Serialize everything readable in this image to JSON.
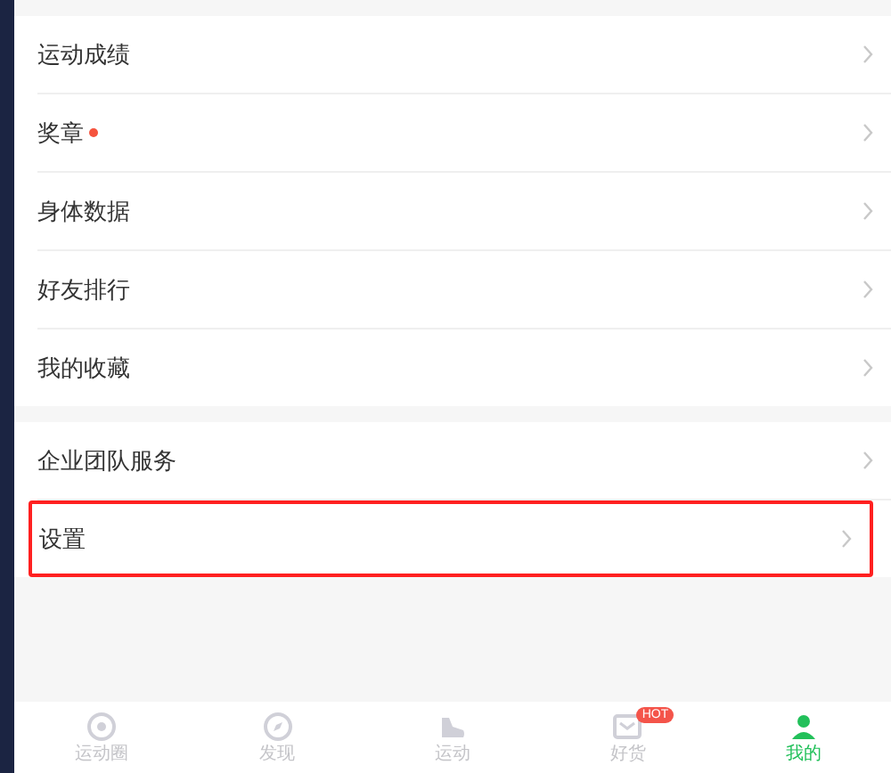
{
  "menu_groups": [
    {
      "items": [
        {
          "label": "运动成绩",
          "badge_dot": false,
          "highlighted": false
        },
        {
          "label": "奖章",
          "badge_dot": true,
          "highlighted": false
        },
        {
          "label": "身体数据",
          "badge_dot": false,
          "highlighted": false
        },
        {
          "label": "好友排行",
          "badge_dot": false,
          "highlighted": false
        },
        {
          "label": "我的收藏",
          "badge_dot": false,
          "highlighted": false
        }
      ]
    },
    {
      "items": [
        {
          "label": "企业团队服务",
          "badge_dot": false,
          "highlighted": false
        },
        {
          "label": "设置",
          "badge_dot": false,
          "highlighted": true
        }
      ]
    }
  ],
  "tab_bar": [
    {
      "label": "运动圈",
      "kind": "circle",
      "selected": false
    },
    {
      "label": "发现",
      "kind": "compass",
      "selected": false
    },
    {
      "label": "运动",
      "kind": "shoe",
      "selected": false
    },
    {
      "label": "好货",
      "kind": "bag",
      "selected": false,
      "badge": "HOT"
    },
    {
      "label": "我的",
      "kind": "person",
      "selected": true
    }
  ]
}
